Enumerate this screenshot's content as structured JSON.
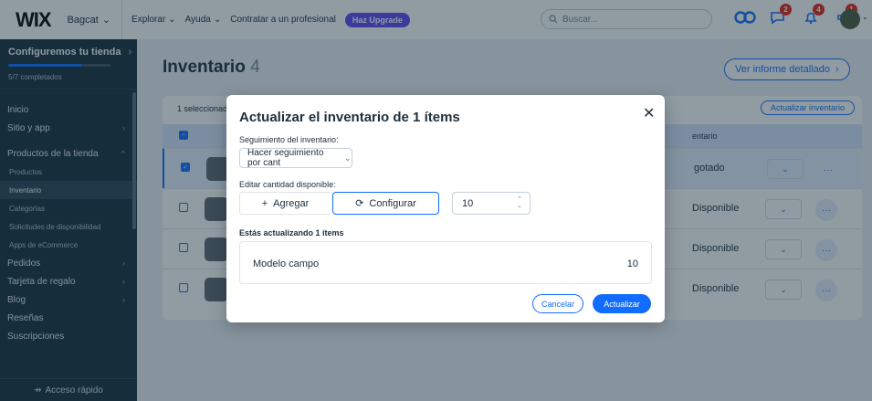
{
  "topbar": {
    "logo": "WIX",
    "site_name": "Bagcat",
    "nav": [
      "Explorar",
      "Ayuda",
      "Contratar a un profesional"
    ],
    "upgrade_label": "Haz Upgrade",
    "search_placeholder": "Buscar...",
    "badges": {
      "chat": "2",
      "notifications": "4",
      "updates": "1"
    }
  },
  "sidebar": {
    "setup_title": "Configuremos tu tienda",
    "setup_progress": 0.71,
    "setup_sub": "5/7 completados",
    "items": [
      {
        "label": "Inicio"
      },
      {
        "label": "Sitio y app"
      },
      {
        "label": "Productos de la tienda"
      },
      {
        "label": "Productos"
      },
      {
        "label": "Inventario"
      },
      {
        "label": "Categorías"
      },
      {
        "label": "Solicitudes de disponibilidad"
      },
      {
        "label": "Apps de eCommerce"
      },
      {
        "label": "Pedidos"
      },
      {
        "label": "Tarjeta de regalo"
      },
      {
        "label": "Blog"
      },
      {
        "label": "Reseñas"
      },
      {
        "label": "Suscripciones"
      }
    ],
    "quick_access": "Acceso rápido"
  },
  "main": {
    "title": "Inventario",
    "count": "4",
    "report_button": "Ver informe detallado",
    "selected_text": "1 seleccionad",
    "update_inventory_button": "Actualizar inventario",
    "column_inventory": "entario",
    "rows": [
      {
        "status": "gotado",
        "selected": true
      },
      {
        "status": "Disponible",
        "selected": false
      },
      {
        "status": "Disponible",
        "selected": false
      },
      {
        "status": "Disponible",
        "selected": false
      }
    ]
  },
  "modal": {
    "title": "Actualizar el inventario de 1 ítems",
    "tracking_label": "Seguimiento del inventario:",
    "tracking_value": "Hacer seguimiento por cant",
    "edit_label": "Editar cantidad disponible:",
    "add_label": "Agregar",
    "configure_label": "Configurar",
    "quantity": "10",
    "updating_label": "Estás actualizando 1 ítems",
    "item": {
      "name": "Modelo campo",
      "qty": "10"
    },
    "cancel_label": "Cancelar",
    "update_label": "Actualizar"
  },
  "colors": {
    "accent": "#116dff",
    "sidebar_bg": "#162d3d",
    "upgrade": "#5a48f5",
    "badge": "#e62214"
  }
}
